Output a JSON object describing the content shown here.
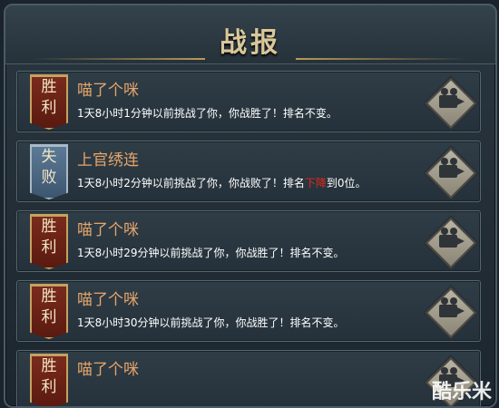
{
  "window": {
    "title": "战报"
  },
  "records": [
    {
      "result": "win",
      "badge": [
        "胜",
        "利"
      ],
      "name": "喵了个咪",
      "message_parts": [
        "1天8小时1分钟以前挑战了你，你战胜了！排名不变。"
      ]
    },
    {
      "result": "lose",
      "badge": [
        "失",
        "败"
      ],
      "name": "上官绣连",
      "message_parts": [
        "1天8小时2分钟以前挑战了你，你战败了！排名",
        "下降",
        "到0位。"
      ]
    },
    {
      "result": "win",
      "badge": [
        "胜",
        "利"
      ],
      "name": "喵了个咪",
      "message_parts": [
        "1天8小时29分钟以前挑战了你，你战胜了！排名不变。"
      ]
    },
    {
      "result": "win",
      "badge": [
        "胜",
        "利"
      ],
      "name": "喵了个咪",
      "message_parts": [
        "1天8小时30分钟以前挑战了你，你战胜了！排名不变。"
      ]
    },
    {
      "result": "win",
      "badge": [
        "胜",
        "利"
      ],
      "name": "喵了个咪",
      "message_parts": [
        ""
      ]
    }
  ],
  "icons": {
    "replay": "replay-camera-icon",
    "close": "close-icon"
  },
  "colors": {
    "name": "#e7a56b",
    "decline": "#e02a1a",
    "title": "#d9c79a"
  },
  "watermark": "酷乐米"
}
